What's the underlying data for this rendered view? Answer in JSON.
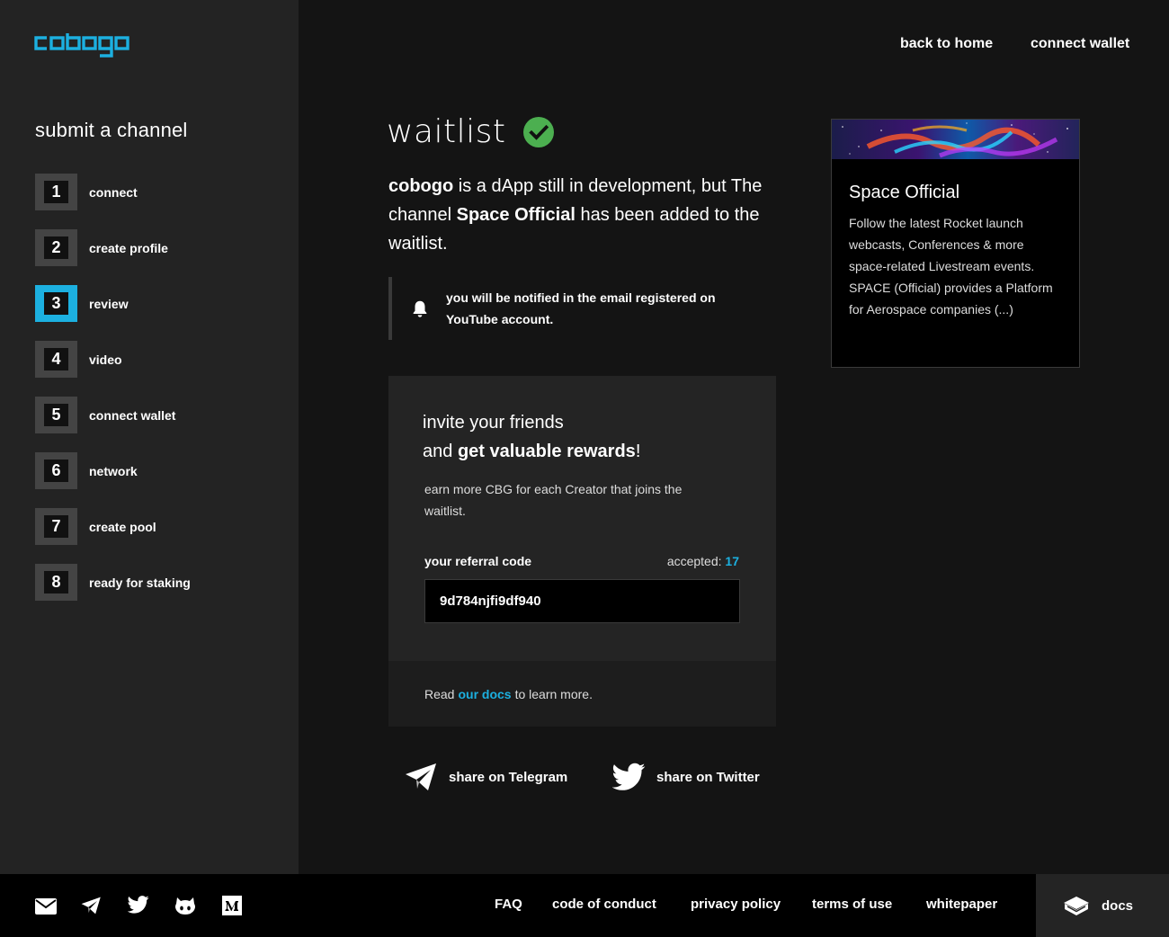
{
  "brand": {
    "name": "cobogo",
    "accent": "#1cb0e0"
  },
  "header": {
    "back_home": "back to home",
    "connect_wallet": "connect wallet"
  },
  "sidebar": {
    "title": "submit a channel",
    "steps": [
      {
        "num": "1",
        "label": "connect"
      },
      {
        "num": "2",
        "label": "create profile"
      },
      {
        "num": "3",
        "label": "review",
        "active": true
      },
      {
        "num": "4",
        "label": "video"
      },
      {
        "num": "5",
        "label": "connect wallet"
      },
      {
        "num": "6",
        "label": "network"
      },
      {
        "num": "7",
        "label": "create pool"
      },
      {
        "num": "8",
        "label": "ready for staking"
      }
    ]
  },
  "main": {
    "title": "waitlist",
    "status_icon": "check-circle-icon",
    "intro": {
      "brand": "cobogo",
      "text1": " is a dApp still in development, but The channel ",
      "channel": "Space Official",
      "text2": " has been added to the waitlist."
    },
    "notice": "you will be notified in the email registered on YouTube account.",
    "invite": {
      "line1": "invite your friends",
      "line2_prefix": "and ",
      "line2_bold": "get valuable rewards",
      "line2_suffix": "!",
      "description": "earn more CBG for each Creator that joins the waitlist.",
      "referral_label": "your referral code",
      "accepted_label": "accepted: ",
      "accepted_count": "17",
      "referral_code": "9d784njfi9df940",
      "footer_prefix": "Read",
      "footer_link": "our docs",
      "footer_suffix": "to learn more."
    },
    "share": {
      "telegram": "share on Telegram",
      "twitter": "share on Twitter"
    }
  },
  "channel_card": {
    "name": "Space Official",
    "description": "Follow the latest Rocket launch webcasts, Conferences & more space-related Livestream events. SPACE (Official) provides a Platform for Aerospace companies (...)"
  },
  "footer": {
    "icons": [
      "mail-icon",
      "telegram-icon",
      "twitter-icon",
      "github-icon",
      "medium-icon"
    ],
    "links": [
      "FAQ",
      "code of conduct",
      "privacy policy",
      "terms of use",
      "whitepaper"
    ],
    "docs": "docs"
  }
}
